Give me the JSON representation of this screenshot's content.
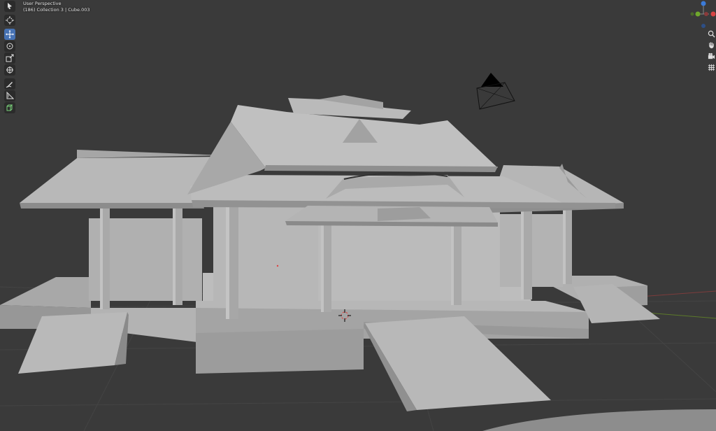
{
  "viewport": {
    "view_label": "User Perspective",
    "collection_label": "(186) Collection 3 | Cube.003"
  },
  "toolbar": {
    "active_tool": "move",
    "tools": [
      "select-box",
      "cursor",
      "move",
      "rotate",
      "scale",
      "transform",
      "annotate",
      "measure",
      "add-cube"
    ]
  },
  "gizmo": {
    "axis_labels": [
      "X",
      "Y",
      "Z"
    ],
    "colors": {
      "x": "#d84444",
      "y": "#6fa82c",
      "z": "#3b7bd8",
      "neg": "#8a3a3a"
    }
  },
  "nav_buttons": [
    "zoom-icon",
    "hand-icon",
    "camera-icon",
    "grid-icon"
  ],
  "colors": {
    "background": "#3a3a3a",
    "grid": "#444444",
    "mesh_light": "#b5b5b5",
    "mesh_mid": "#9a9a9a",
    "mesh_dark": "#7c7c7c",
    "active": "#4772b3"
  }
}
